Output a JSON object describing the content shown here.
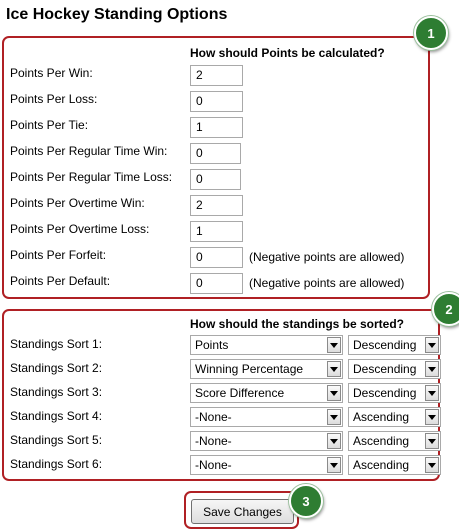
{
  "page_title": "Ice Hockey Standing Options",
  "badges": [
    "1",
    "2",
    "3"
  ],
  "accent_colors": {
    "callout_border": "#b02024",
    "badge": "#2e7d32"
  },
  "points_section": {
    "heading": "How should Points be calculated?",
    "fields": [
      {
        "label": "Points Per Win:",
        "value": "2"
      },
      {
        "label": "Points Per Loss:",
        "value": "0"
      },
      {
        "label": "Points Per Tie:",
        "value": "1"
      },
      {
        "label": "Points Per Regular Time Win:",
        "value": "0"
      },
      {
        "label": "Points Per Regular Time Loss:",
        "value": "0"
      },
      {
        "label": "Points Per Overtime Win:",
        "value": "2"
      },
      {
        "label": "Points Per Overtime Loss:",
        "value": "1"
      },
      {
        "label": "Points Per Forfeit:",
        "value": "0",
        "note": "(Negative points are allowed)"
      },
      {
        "label": "Points Per Default:",
        "value": "0",
        "note": "(Negative points are allowed)"
      }
    ]
  },
  "sort_section": {
    "heading": "How should the standings be sorted?",
    "rows": [
      {
        "label": "Standings Sort 1:",
        "field": "Points",
        "order": "Descending"
      },
      {
        "label": "Standings Sort 2:",
        "field": "Winning Percentage",
        "order": "Descending"
      },
      {
        "label": "Standings Sort 3:",
        "field": "Score Difference",
        "order": "Descending"
      },
      {
        "label": "Standings Sort 4:",
        "field": "-None-",
        "order": "Ascending"
      },
      {
        "label": "Standings Sort 5:",
        "field": "-None-",
        "order": "Ascending"
      },
      {
        "label": "Standings Sort 6:",
        "field": "-None-",
        "order": "Ascending"
      }
    ]
  },
  "save_button": "Save Changes"
}
